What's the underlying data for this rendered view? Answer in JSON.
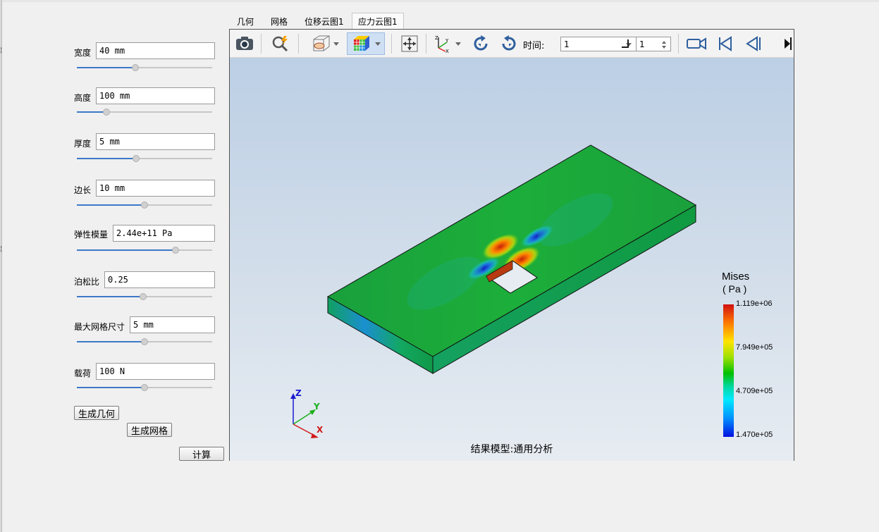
{
  "params": [
    {
      "label": "宽度",
      "value": "40 mm",
      "slider": 0.43
    },
    {
      "label": "高度",
      "value": "100 mm",
      "slider": 0.22
    },
    {
      "label": "厚度",
      "value": "5 mm",
      "slider": 0.44
    },
    {
      "label": "边长",
      "value": "10 mm",
      "slider": 0.5
    },
    {
      "label": "弹性模量",
      "value": "2.44e+11 Pa",
      "slider": 0.73
    },
    {
      "label": "泊松比",
      "value": "0.25",
      "slider": 0.49
    },
    {
      "label": "最大网格尺寸",
      "value": "5 mm",
      "slider": 0.5
    },
    {
      "label": "载荷",
      "value": "100 N",
      "slider": 0.5
    }
  ],
  "buttons": {
    "generate_geometry": "生成几何",
    "generate_mesh": "生成网格",
    "compute": "计算"
  },
  "tabs": [
    "几何",
    "网格",
    "位移云图1",
    "应力云图1"
  ],
  "active_tab": "应力云图1",
  "toolbar": {
    "icons": [
      "camera-icon",
      "zoom-fit-icon",
      "section-view-icon",
      "color-cube-icon",
      "move-icon",
      "axes-orientation-icon",
      "rotate-cw-icon",
      "rotate-ccw-icon",
      "video-record-icon",
      "first-frame-icon",
      "prev-frame-icon",
      "next-frame-icon"
    ],
    "time_label": "时间:",
    "time_value": "1",
    "step_value": "1"
  },
  "legend": {
    "title": "Mises",
    "unit": "( Pa )",
    "ticks": [
      "1.119e+06",
      "7.949e+05",
      "4.709e+05",
      "1.470e+05"
    ],
    "colors": {
      "max": "#d01010",
      "mid": "#00c000",
      "min": "#0010e0"
    }
  },
  "triad": {
    "z": "Z",
    "y": "Y",
    "x": "X"
  },
  "caption": "结果模型:通用分析"
}
